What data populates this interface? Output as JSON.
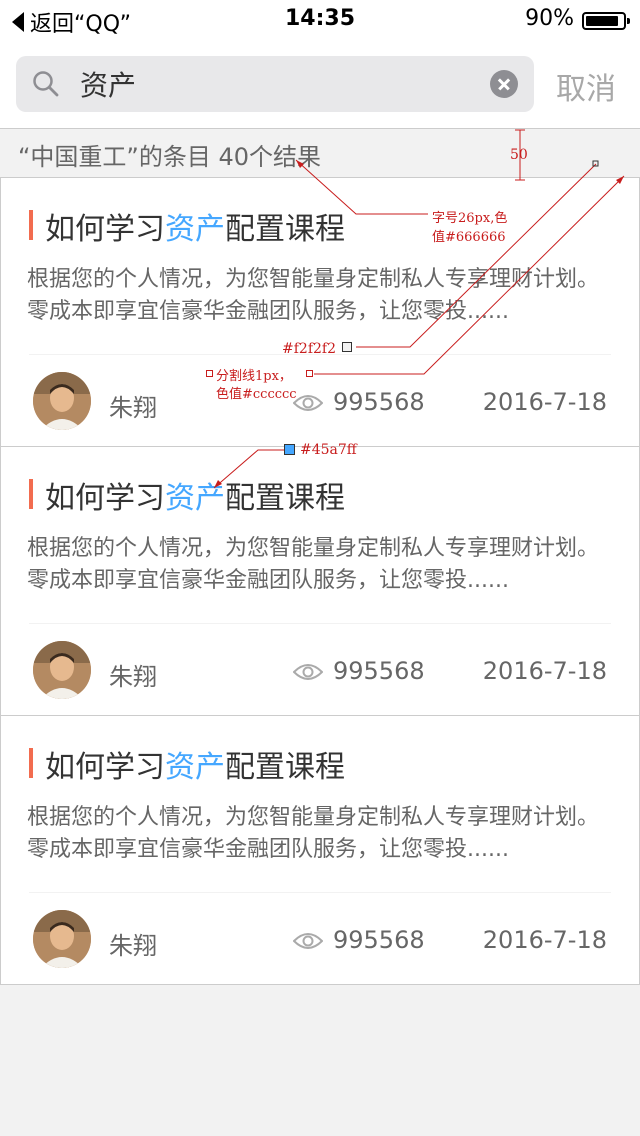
{
  "status_bar": {
    "back_label": "返回“QQ”",
    "time": "14:35",
    "battery_percent": "90%",
    "battery_level": 0.9
  },
  "search": {
    "query": "资产",
    "cancel_label": "取消"
  },
  "result_header": {
    "text": "“中国重工”的条目 40个结果"
  },
  "cards": [
    {
      "title_before": "如何学习",
      "title_highlight": "资产",
      "title_after": "配置课程",
      "summary": "根据您的个人情况，为您智能量身定制私人专享理财计划。零成本即享宜信豪华金融团队服务，让您零投......",
      "author": "朱翔",
      "views": "995568",
      "date": "2016-7-18"
    },
    {
      "title_before": "如何学习",
      "title_highlight": "资产",
      "title_after": "配置课程",
      "summary": "根据您的个人情况，为您智能量身定制私人专享理财计划。零成本即享宜信豪华金融团队服务，让您零投......",
      "author": "朱翔",
      "views": "995568",
      "date": "2016-7-18"
    },
    {
      "title_before": "如何学习",
      "title_highlight": "资产",
      "title_after": "配置课程",
      "summary": "根据您的个人情况，为您智能量身定制私人专享理财计划。零成本即享宜信豪华金融团队服务，让您零投......",
      "author": "朱翔",
      "views": "995568",
      "date": "2016-7-18"
    }
  ],
  "annotations": {
    "height_label": "50",
    "font_note_line1": "字号26px,色",
    "font_note_line2": "值#666666",
    "divider_color_note": "#f2f2f2",
    "divider_line_note_line1": "分割线1px，",
    "divider_line_note_line2": "色值#cccccc",
    "highlight_color_note": "#45a7ff"
  },
  "colors": {
    "accent": "#45a7ff",
    "title_bar": "#f26c4f",
    "background": "#f2f2f2",
    "annotation": "#c81d1d"
  }
}
